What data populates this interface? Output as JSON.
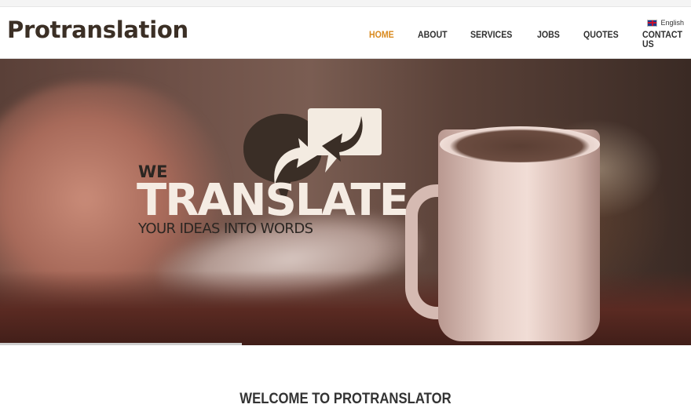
{
  "header": {
    "logo": "Protranslation",
    "nav": [
      {
        "label": "HOME",
        "active": true
      },
      {
        "label": "ABOUT",
        "active": false
      },
      {
        "label": "SERVICES",
        "active": false
      },
      {
        "label": "JOBS",
        "active": false
      },
      {
        "label": "QUOTES",
        "active": false
      },
      {
        "label": "CONTACT US",
        "active": false
      }
    ],
    "language": {
      "label": "English",
      "icon": "uk-flag-icon"
    }
  },
  "hero": {
    "we": "WE",
    "headline": "TRANSLATE",
    "tagline": "YOUR IDEAS INTO WORDS",
    "icon": "speech-bubbles-arrows-icon",
    "slider_progress_percent": 35
  },
  "welcome": {
    "title": "WELCOME TO PROTRANSLATOR"
  },
  "colors": {
    "accent": "#d98a1e",
    "logo": "#3b2f25",
    "nav_text": "#2f2f2f",
    "headline": "#f5ece3",
    "dark_text": "#2b2622"
  }
}
